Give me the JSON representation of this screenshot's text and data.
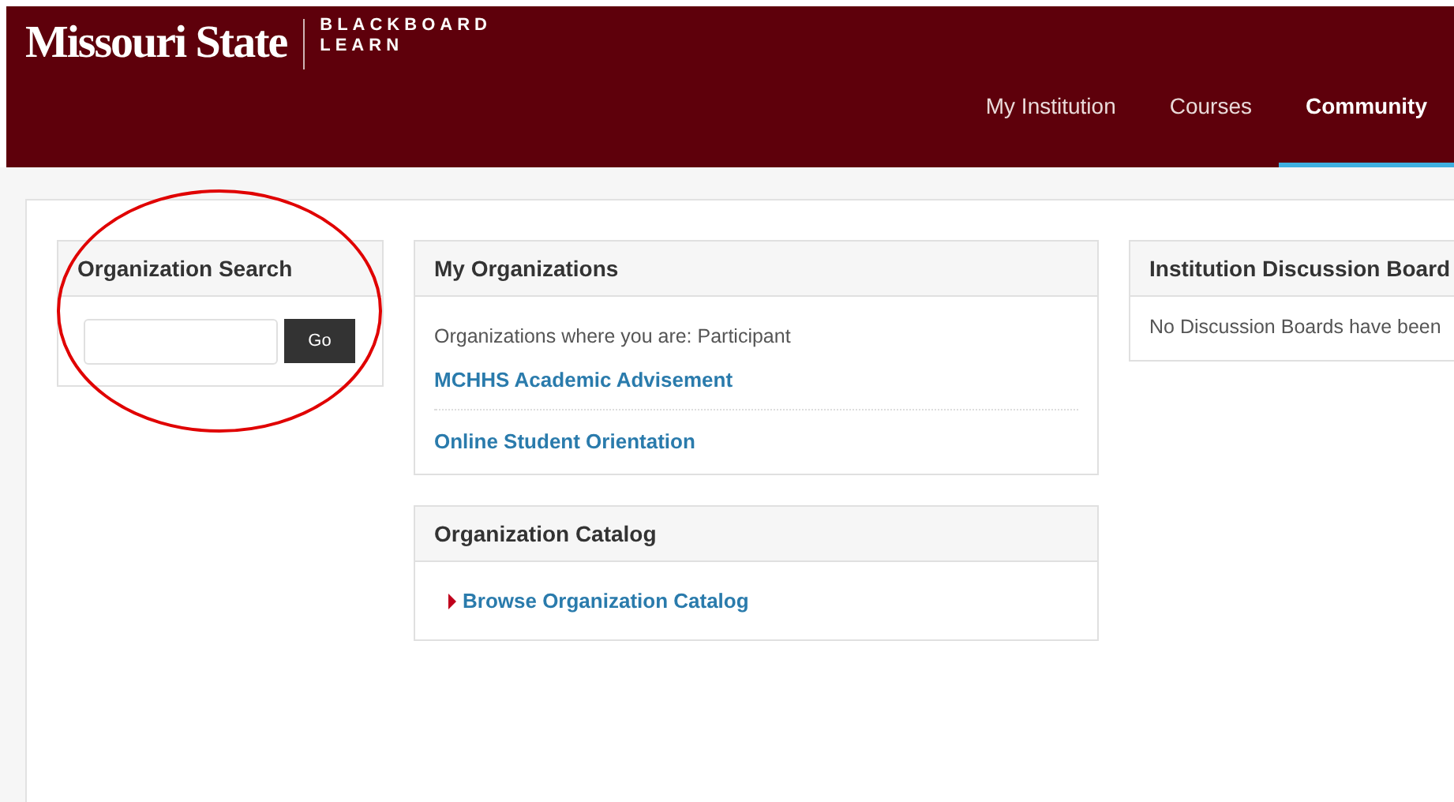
{
  "header": {
    "logo": "Missouri State",
    "product_line_1": "BLACKBOARD",
    "product_line_2": "LEARN",
    "tabs": [
      {
        "label": "My Institution",
        "selected": false
      },
      {
        "label": "Courses",
        "selected": false
      },
      {
        "label": "Community",
        "selected": true
      }
    ]
  },
  "organization_search": {
    "title": "Organization Search",
    "button": "Go"
  },
  "my_organizations": {
    "title": "My Organizations",
    "note": "Organizations where you are: Participant",
    "items": [
      "MCHHS Academic Advisement",
      "Online Student Orientation"
    ]
  },
  "organization_catalog": {
    "title": "Organization Catalog",
    "link": "Browse Organization Catalog"
  },
  "discussion_boards": {
    "title": "Institution Discussion Board",
    "message": "No Discussion Boards have been"
  }
}
